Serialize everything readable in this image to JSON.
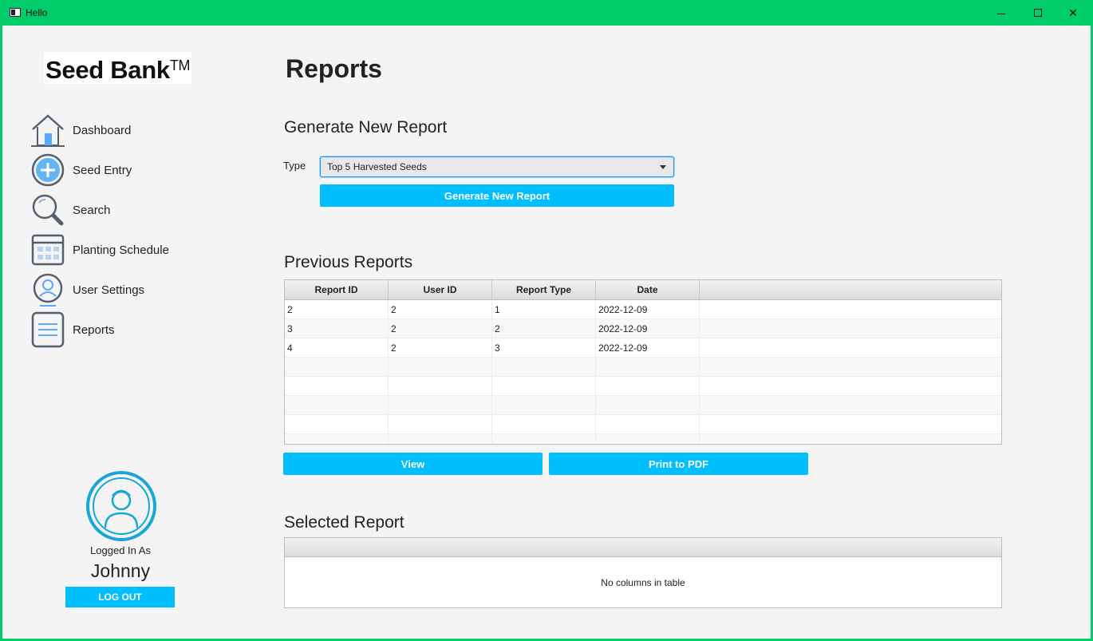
{
  "window": {
    "title": "Hello"
  },
  "brand": {
    "name": "Seed Bank",
    "mark": "TM"
  },
  "nav": [
    {
      "label": "Dashboard",
      "icon": "house-icon"
    },
    {
      "label": "Seed Entry",
      "icon": "plus-circle-icon"
    },
    {
      "label": "Search",
      "icon": "magnifier-icon"
    },
    {
      "label": "Planting Schedule",
      "icon": "calendar-icon"
    },
    {
      "label": "User Settings",
      "icon": "user-icon"
    },
    {
      "label": "Reports",
      "icon": "document-icon"
    }
  ],
  "user": {
    "logged_label": "Logged In As",
    "name": "Johnny",
    "logout_label": "LOG OUT"
  },
  "page": {
    "title": "Reports"
  },
  "generate": {
    "heading": "Generate New Report",
    "type_label": "Type",
    "type_value": "Top 5 Harvested Seeds",
    "button": "Generate New Report"
  },
  "previous": {
    "heading": "Previous Reports",
    "columns": [
      "Report ID",
      "User ID",
      "Report Type",
      "Date"
    ],
    "rows": [
      [
        "2",
        "2",
        "1",
        "2022-12-09"
      ],
      [
        "3",
        "2",
        "2",
        "2022-12-09"
      ],
      [
        "4",
        "2",
        "3",
        "2022-12-09"
      ]
    ],
    "view_button": "View",
    "pdf_button": "Print to PDF"
  },
  "selected": {
    "heading": "Selected Report",
    "empty_text": "No columns in table"
  },
  "colors": {
    "accent": "#00bfff",
    "titlebar": "#00cc6a",
    "background": "#f4f4f4"
  }
}
